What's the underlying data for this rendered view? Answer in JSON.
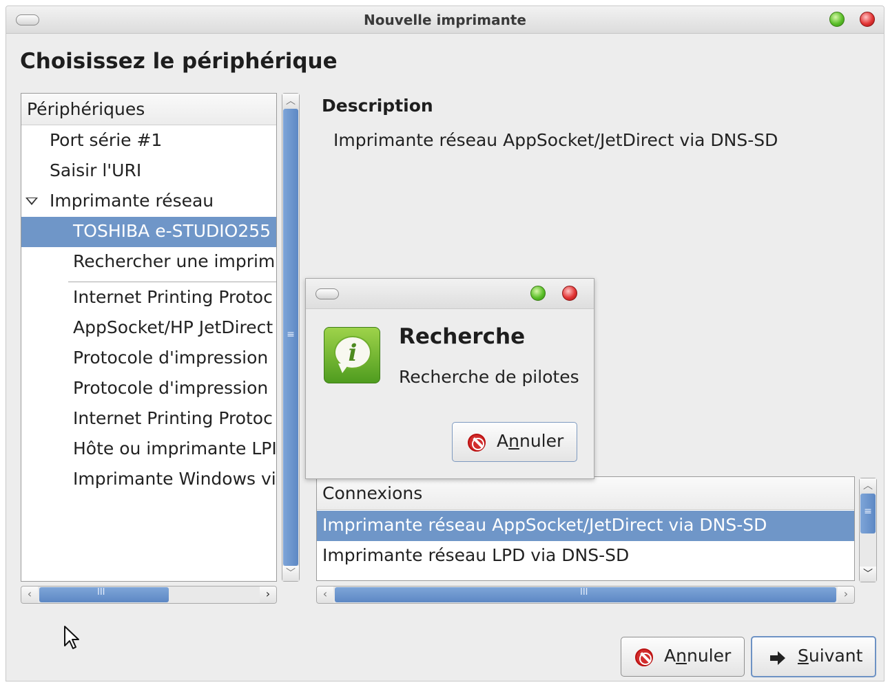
{
  "window": {
    "title": "Nouvelle imprimante",
    "heading": "Choisissez le périphérique"
  },
  "devices": {
    "header": "Périphériques",
    "items": [
      {
        "label": "Port série #1",
        "level": 1,
        "selected": false
      },
      {
        "label": "Saisir l'URI",
        "level": 1,
        "selected": false
      },
      {
        "label": "Imprimante réseau",
        "level": 1,
        "selected": false,
        "expanded": true
      },
      {
        "label": "TOSHIBA e-STUDIO255 (",
        "level": 2,
        "selected": true
      },
      {
        "label": "Rechercher une imprim",
        "level": 2,
        "selected": false
      },
      {
        "label": "Internet Printing Protoc",
        "level": 2,
        "selected": false
      },
      {
        "label": "AppSocket/HP JetDirect",
        "level": 2,
        "selected": false
      },
      {
        "label": "Protocole d'impression",
        "level": 2,
        "selected": false
      },
      {
        "label": "Protocole d'impression",
        "level": 2,
        "selected": false
      },
      {
        "label": "Internet Printing Protoc",
        "level": 2,
        "selected": false
      },
      {
        "label": "Hôte ou imprimante LPI",
        "level": 2,
        "selected": false
      },
      {
        "label": "Imprimante Windows vi",
        "level": 2,
        "selected": false
      }
    ]
  },
  "description": {
    "title": "Description",
    "text": "Imprimante réseau AppSocket/JetDirect via DNS-SD"
  },
  "connections": {
    "header": "Connexions",
    "items": [
      {
        "label": "Imprimante réseau AppSocket/JetDirect via DNS-SD",
        "selected": true
      },
      {
        "label": "Imprimante réseau LPD via DNS-SD",
        "selected": false
      }
    ]
  },
  "dialog": {
    "title": "Recherche",
    "message": "Recherche de pilotes",
    "cancel": {
      "prefix": "A",
      "mnemonic": "n",
      "suffix": "nuler"
    }
  },
  "buttons": {
    "cancel": {
      "prefix": "A",
      "mnemonic": "n",
      "suffix": "nuler"
    },
    "next": {
      "prefix": "",
      "mnemonic": "S",
      "suffix": "uivant"
    }
  },
  "icons": {
    "menu": "window-menu-icon",
    "maximize": "green-button-icon",
    "close": "red-button-icon",
    "info": "info-icon",
    "cancel": "stop-icon",
    "next": "arrow-right-icon",
    "cursor": "mouse-pointer-icon"
  },
  "colors": {
    "selection": "#6f96c8",
    "scroll_thumb": "#5d88c4",
    "window_bg": "#ededed"
  }
}
